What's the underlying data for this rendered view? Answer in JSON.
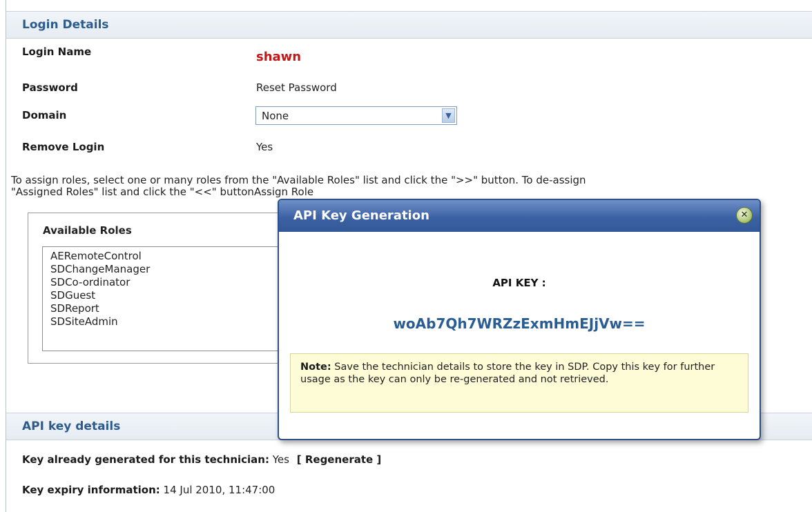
{
  "login_details": {
    "header": "Login Details",
    "login_name_label": "Login Name",
    "login_name_value": "shawn",
    "password_label": "Password",
    "password_value": "Reset Password",
    "domain_label": "Domain",
    "domain_selected": "None",
    "remove_login_label": "Remove Login",
    "remove_login_value": "Yes"
  },
  "roles": {
    "instructions_line1": "To assign roles, select one or many roles from the \"Available Roles\" list and click the \">>\" button. To de-assign",
    "instructions_line2": "\"Assigned Roles\" list and click the \"<<\" buttonAssign Role",
    "available_title": "Available Roles",
    "available": [
      "AERemoteControl",
      "SDChangeManager",
      "SDCo-ordinator",
      "SDGuest",
      "SDReport",
      "SDSiteAdmin"
    ]
  },
  "api_key_details": {
    "header": "API key details",
    "generated_label": "Key already generated for this technician:",
    "generated_value": "Yes",
    "regenerate_label": "[ Regenerate ]",
    "expiry_label": "Key expiry information:",
    "expiry_value": "14 Jul 2010, 11:47:00"
  },
  "modal": {
    "title": "API Key Generation",
    "close_icon": "close-x-icon",
    "key_label": "API KEY :",
    "key_value": "woAb7Qh7WRZzExmHmEJjVw==",
    "note_label": "Note:",
    "note_text": " Save the technician details to store the key in SDP. Copy this key for further usage as the key can only be re-generated and not retrieved."
  },
  "colors": {
    "header_text": "#2d5c8c",
    "login_name": "#c01818",
    "modal_title_bg": "#3c62a5",
    "api_key_text": "#2a5c94",
    "note_bg": "#fdfcd6"
  }
}
